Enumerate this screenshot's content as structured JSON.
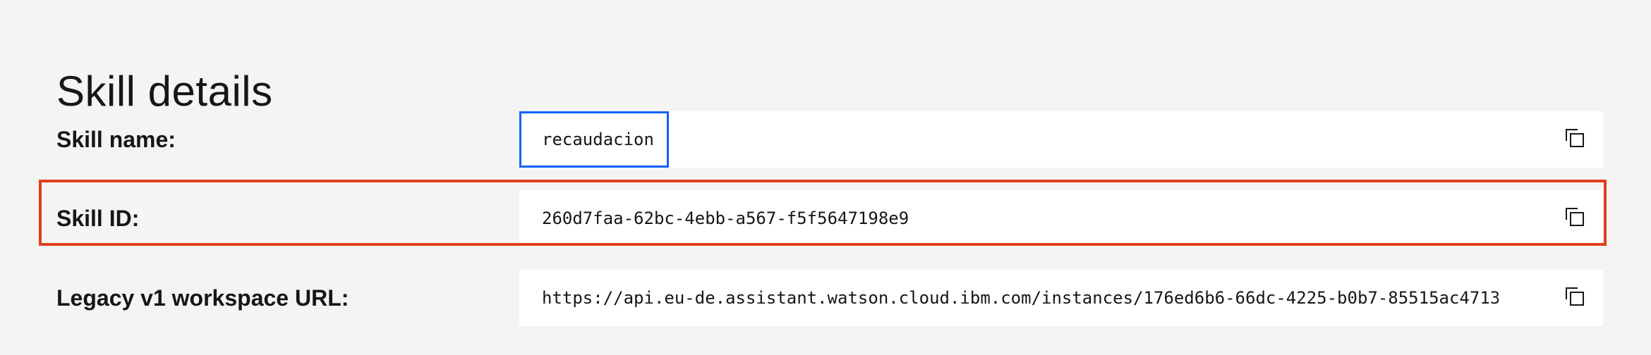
{
  "page": {
    "title": "Skill details"
  },
  "rows": [
    {
      "label": "Skill name:",
      "value": "recaudacion",
      "copy_icon": "copy-icon"
    },
    {
      "label": "Skill ID:",
      "value": "260d7faa-62bc-4ebb-a567-f5f5647198e9",
      "copy_icon": "copy-icon"
    },
    {
      "label": "Legacy v1 workspace URL:",
      "value": "https://api.eu-de.assistant.watson.cloud.ibm.com/instances/176ed6b6-66dc-4225-b0b7-85515ac4713",
      "copy_icon": "copy-icon"
    }
  ],
  "colors": {
    "background": "#f4f4f4",
    "field_background": "#ffffff",
    "focus_outline": "#0f62fe",
    "highlight_outline": "#e0401f",
    "text": "#161616"
  }
}
